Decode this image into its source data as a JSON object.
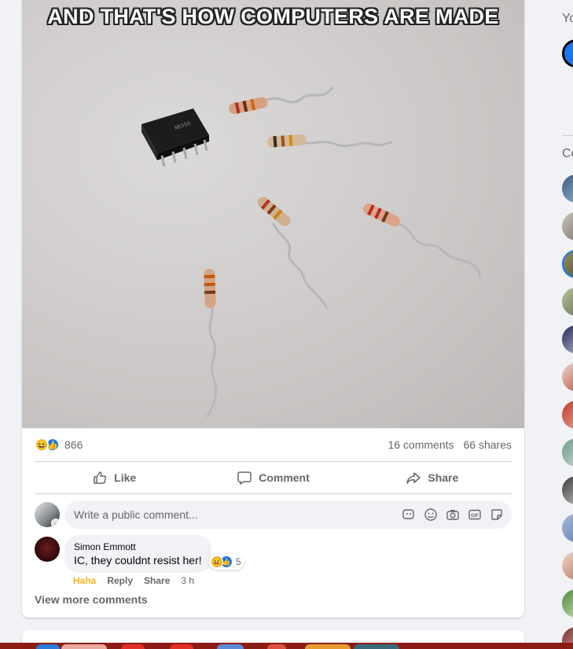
{
  "post": {
    "meme_caption": "AND THAT'S HOW COMPUTERS ARE MADE",
    "reactions": {
      "icons": [
        "haha-icon",
        "like-icon"
      ],
      "count": "866"
    },
    "comments_count": "16 comments",
    "shares_count": "66 shares",
    "actions": {
      "like": "Like",
      "comment": "Comment",
      "share": "Share"
    },
    "composer": {
      "placeholder": "Write a public comment..."
    },
    "comments": [
      {
        "author": "Simon Emmott",
        "text": "IC, they couldnt resist her!",
        "reaction_count": "5",
        "reaction_label": "Haha",
        "reply": "Reply",
        "share": "Share",
        "time": "3 h"
      }
    ],
    "view_more": "View more comments"
  },
  "sidebar": {
    "section_title": "Yo",
    "contacts_title": "Co"
  },
  "colors": {
    "accent": "#1877f2",
    "haha": "#f7b125",
    "text_secondary": "#65676b"
  }
}
